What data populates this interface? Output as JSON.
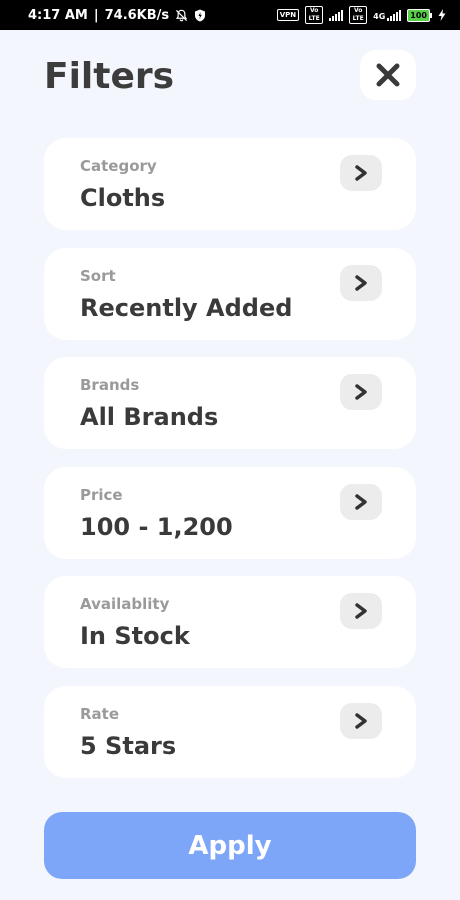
{
  "status_bar": {
    "time": "4:17 AM",
    "network_speed": "74.6KB/s",
    "vpn_label": "VPN",
    "volte_label_1": "Vo LTE",
    "volte_label_2": "Vo LTE",
    "network_type": "4G",
    "battery": "100"
  },
  "header": {
    "title": "Filters"
  },
  "filters": [
    {
      "label": "Category",
      "value": "Cloths"
    },
    {
      "label": "Sort",
      "value": "Recently Added"
    },
    {
      "label": "Brands",
      "value": "All Brands"
    },
    {
      "label": "Price",
      "value": "100 - 1,200"
    },
    {
      "label": "Availablity",
      "value": "In Stock"
    },
    {
      "label": "Rate",
      "value": "5 Stars"
    }
  ],
  "apply_label": "Apply",
  "colors": {
    "background": "#f4f6fd",
    "card": "#ffffff",
    "apply_button": "#7ea6f8",
    "chevron_bg": "#ececec",
    "title_text": "#3c3c3c",
    "label_text": "#9a9a9a"
  }
}
